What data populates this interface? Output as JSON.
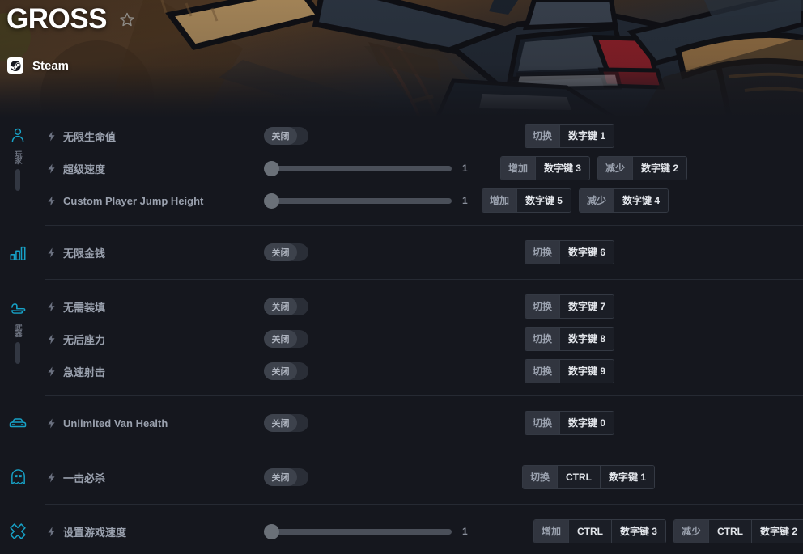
{
  "header": {
    "game_title": "GROSS",
    "favorite_icon": "star-outline-icon",
    "platform_icon": "steam-icon",
    "platform_name": "Steam"
  },
  "colors": {
    "accent_cyan": "#17a2c7",
    "background": "#15171e",
    "row_label": "#9aa1ae",
    "key_chip_bg": "#1b1e26",
    "action_chip_bg": "#31353f",
    "toggle_off_bg": "#2a2e37",
    "toggle_knob": "#3d424c",
    "slider_track": "#4a4f59",
    "slider_knob": "#6a7078",
    "separator": "#262a33",
    "artwork_brown": "#5f4226",
    "artwork_tan": "#a77c48",
    "artwork_red": "#a01f28",
    "artwork_navy": "#2a3441"
  },
  "sidebar": {
    "categories": [
      {
        "icon": "person-icon",
        "label": "玩家",
        "indicator": true
      },
      {
        "icon": "bar-chart-icon",
        "label": "",
        "indicator": false
      },
      {
        "icon": "pointing-hand-icon",
        "label": "武器",
        "indicator": true
      },
      {
        "icon": "car-icon",
        "label": "",
        "indicator": false
      },
      {
        "icon": "ghost-icon",
        "label": "",
        "indicator": false
      },
      {
        "icon": "cross-icon",
        "label": "",
        "indicator": false
      }
    ]
  },
  "labels": {
    "toggle_state_off": "关闭",
    "action_toggle": "切换",
    "action_increase": "增加",
    "action_decrease": "减少",
    "key_ctrl": "CTRL"
  },
  "groups": [
    {
      "name": "player-group",
      "cheats": [
        {
          "label": "无限生命值",
          "control": "toggle",
          "state": "关闭",
          "hotkeys": [
            {
              "action": "切换",
              "keys": [
                "数字键 1"
              ]
            }
          ]
        },
        {
          "label": "超级速度",
          "control": "slider",
          "value": "1",
          "hotkeys": [
            {
              "action": "增加",
              "keys": [
                "数字键 3"
              ]
            },
            {
              "action": "减少",
              "keys": [
                "数字键 2"
              ]
            }
          ]
        },
        {
          "label": "Custom Player Jump Height",
          "control": "slider",
          "value": "1",
          "hotkeys": [
            {
              "action": "增加",
              "keys": [
                "数字键 5"
              ]
            },
            {
              "action": "减少",
              "keys": [
                "数字键 4"
              ]
            }
          ]
        }
      ]
    },
    {
      "name": "money-group",
      "cheats": [
        {
          "label": "无限金钱",
          "control": "toggle",
          "state": "关闭",
          "hotkeys": [
            {
              "action": "切换",
              "keys": [
                "数字键 6"
              ]
            }
          ]
        }
      ]
    },
    {
      "name": "weapons-group",
      "cheats": [
        {
          "label": "无需装填",
          "control": "toggle",
          "state": "关闭",
          "hotkeys": [
            {
              "action": "切换",
              "keys": [
                "数字键 7"
              ]
            }
          ]
        },
        {
          "label": "无后座力",
          "control": "toggle",
          "state": "关闭",
          "hotkeys": [
            {
              "action": "切换",
              "keys": [
                "数字键 8"
              ]
            }
          ]
        },
        {
          "label": "急速射击",
          "control": "toggle",
          "state": "关闭",
          "hotkeys": [
            {
              "action": "切换",
              "keys": [
                "数字键 9"
              ]
            }
          ]
        }
      ]
    },
    {
      "name": "vehicle-group",
      "cheats": [
        {
          "label": "Unlimited Van Health",
          "control": "toggle",
          "state": "关闭",
          "hotkeys": [
            {
              "action": "切换",
              "keys": [
                "数字键 0"
              ]
            }
          ]
        }
      ]
    },
    {
      "name": "enemies-group",
      "cheats": [
        {
          "label": "一击必杀",
          "control": "toggle",
          "state": "关闭",
          "hotkeys": [
            {
              "action": "切换",
              "keys": [
                "CTRL",
                "数字键 1"
              ]
            }
          ]
        }
      ]
    },
    {
      "name": "game-group",
      "cheats": [
        {
          "label": "设置游戏速度",
          "control": "slider",
          "value": "1",
          "hotkeys": [
            {
              "action": "增加",
              "keys": [
                "CTRL",
                "数字键 3"
              ]
            },
            {
              "action": "减少",
              "keys": [
                "CTRL",
                "数字键 2"
              ]
            }
          ]
        }
      ]
    }
  ]
}
